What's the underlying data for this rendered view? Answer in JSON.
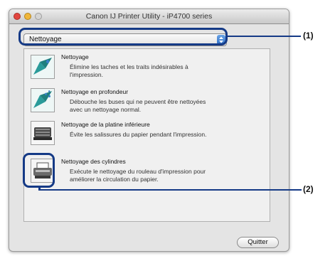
{
  "window": {
    "title": "Canon IJ Printer Utility - iP4700 series"
  },
  "dropdown": {
    "selected": "Nettoyage"
  },
  "items": [
    {
      "title": "Nettoyage",
      "desc": [
        "Élimine les taches et les traits indésirables à",
        "l'impression."
      ],
      "icon": "cleaning-icon"
    },
    {
      "title": "Nettoyage en profondeur",
      "desc": [
        "Débouche les buses qui ne peuvent être nettoyées",
        "avec un nettoyage normal."
      ],
      "icon": "deep-cleaning-icon"
    },
    {
      "title": "Nettoyage de la platine inférieure",
      "desc": [
        "Évite les salissures du papier pendant l'impression."
      ],
      "icon": "bottom-plate-cleaning-icon"
    },
    {
      "title": "Nettoyage des cylindres",
      "desc": [
        "Exécute le nettoyage du rouleau d'impression pour",
        "améliorer la circulation du papier."
      ],
      "icon": "roller-cleaning-icon"
    }
  ],
  "buttons": {
    "quit": "Quitter"
  },
  "callouts": [
    "(1)",
    "(2)"
  ],
  "colors": {
    "accent": "#153a86",
    "icon_teal": "#2a9b9a"
  }
}
